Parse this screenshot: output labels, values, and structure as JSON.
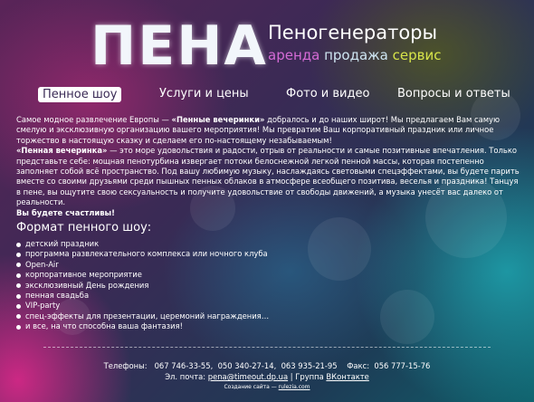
{
  "header": {
    "logo": "ПЕНА",
    "tagline": "Пеногенераторы",
    "services": [
      "аренда",
      "продажа",
      "сервис"
    ]
  },
  "nav": {
    "items": [
      {
        "label": "Пенное шоу",
        "active": true
      },
      {
        "label": "Услуги и цены",
        "active": false
      },
      {
        "label": "Фото и видео",
        "active": false
      },
      {
        "label": "Вопросы и ответы",
        "active": false
      }
    ]
  },
  "intro": {
    "p1_a": "Самое модное развлечение Европы — ",
    "p1_b": "«Пенные вечеринки»",
    "p1_c": " добралось и до наших широт! Мы предлагаем Вам самую смелую и эксклюзивную организацию вашего мероприятия! Мы превратим Ваш корпоративный праздник или личное торжество в настоящую сказку и сделаем его по-настоящему незабываемым!",
    "p2_a": "«Пенная вечеринка»",
    "p2_b": " — это море удовольствия и радости, отрыв от реальности и самые позитивные впечатления. Только представьте себе: мощная пенотурбина извергает потоки белоснежной легкой пенной массы, которая постепенно заполняет собой всё пространство. Под вашу любимую музыку, наслаждаясь световыми спецэффектами, вы будете парить вместе со своими друзьями среди пышных пенных облаков в атмосфере всеобщего позитива, веселья и праздника! Танцуя в пене, вы ощутите свою сексуальность и получите удовольствие от свободы движений, а музыка унесёт вас далеко от реальности.",
    "closing": "Вы будете счастливы!"
  },
  "format": {
    "title": "Формат пенного шоу:",
    "items": [
      "детский праздник",
      "программа развлекательного комплекса или ночного клуба",
      "Open-Air",
      "корпоративное мероприятие",
      "эксклюзивный День рождения",
      "пенная свадьба",
      "VIP-party",
      "спец-эффекты для презентации, церемоний награждения…",
      "и все, на что способна ваша фантазия!"
    ]
  },
  "footer": {
    "phones_label": "Телефоны:",
    "phones": [
      "067 746-33-55,",
      "050 340-27-14,",
      "063 935-21-95"
    ],
    "fax_label": "Факс:",
    "fax": "056 777-15-76",
    "email_label": "Эл. почта:",
    "email": "pena@timeout.dp.ua",
    "group_label": "Группа",
    "group_link": "ВКонтакте",
    "credit_label": "Создание сайта —",
    "credit_link": "rulezia.com"
  },
  "colors": {
    "services_1": "#d56bd6",
    "services_2": "#cfe6f2",
    "services_3": "#d7e44a",
    "active_tab_bg": "#ffffff"
  }
}
